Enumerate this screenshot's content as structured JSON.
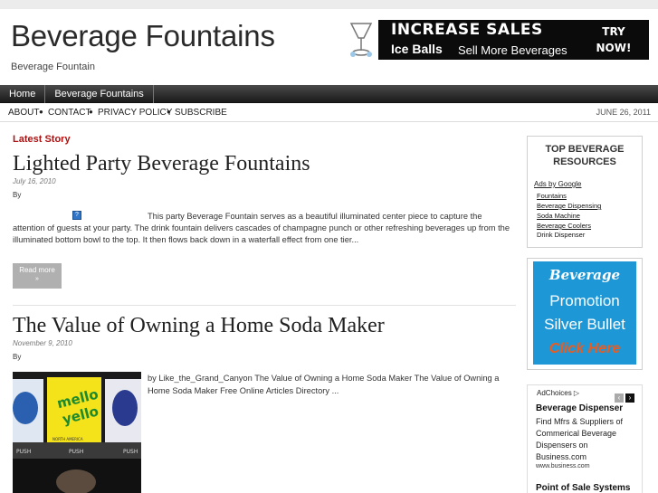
{
  "site": {
    "title": "Beverage Fountains",
    "description": "Beverage Fountain"
  },
  "banner": {
    "headline": "INCREASE SALES",
    "brand": "Ice Balls",
    "tagline": "Sell More Beverages",
    "cta_line1": "TRY",
    "cta_line2": "NOW!"
  },
  "main_nav": [
    "Home",
    "Beverage Fountains"
  ],
  "sub_nav": {
    "items": [
      "ABOUT",
      "CONTACT",
      "PRIVACY POLICY",
      "SUBSCRIBE"
    ],
    "separator": "●",
    "date": "JUNE 26, 2011"
  },
  "section_label": "Latest Story",
  "posts": [
    {
      "title": "Lighted Party Beverage Fountains",
      "date": "July 16, 2010",
      "by": "By",
      "excerpt": "This party Beverage Fountain serves as a beautiful illuminated center piece to capture the attention of guests at your party. The drink fountain delivers cascades of champagne punch or other refreshing beverages up from the illuminated bottom bowl to the top. It then flows back down in a waterfall effect from one tier...",
      "image_placeholder": "?",
      "read_more": "Read more",
      "read_more_dot": "»"
    },
    {
      "title": "The Value of Owning a Home Soda Maker",
      "date": "November 9, 2010",
      "by": "By",
      "excerpt": "by Like_the_Grand_Canyon The Value of Owning a Home Soda Maker The Value of Owning a Home Soda Maker Free Online Articles Directory ...",
      "photo_labels": [
        "mello",
        "yello",
        "PUSH",
        "PUSH",
        "PUSH",
        "NORTH AMERICA"
      ]
    }
  ],
  "sidebar": {
    "resources": {
      "heading_line1": "TOP BEVERAGE",
      "heading_line2": "RESOURCES",
      "ads_by": "Ads by Google",
      "links": [
        "Fountains",
        "Beverage Dispensing",
        "Soda Machine",
        "Beverage Coolers",
        "Drink Dispenser"
      ]
    },
    "promo": {
      "line1": "Beverage",
      "line2": "Promotion",
      "line3": "Silver Bullet",
      "line4": "Click Here"
    },
    "ad": {
      "adchoices": "AdChoices",
      "adchoices_icon": "▷",
      "title": "Beverage Dispenser",
      "text": "Find Mfrs & Suppliers of Commerical Beverage Dispensers on Business.com",
      "url": "www.business.com",
      "title2": "Point of Sale Systems",
      "prev": "‹",
      "next": "›"
    }
  },
  "colors": {
    "accent_red": "#b01010",
    "promo_blue": "#1e97d7",
    "promo_orange": "#f05a1a",
    "nav_dark": "#1a1a1a"
  }
}
